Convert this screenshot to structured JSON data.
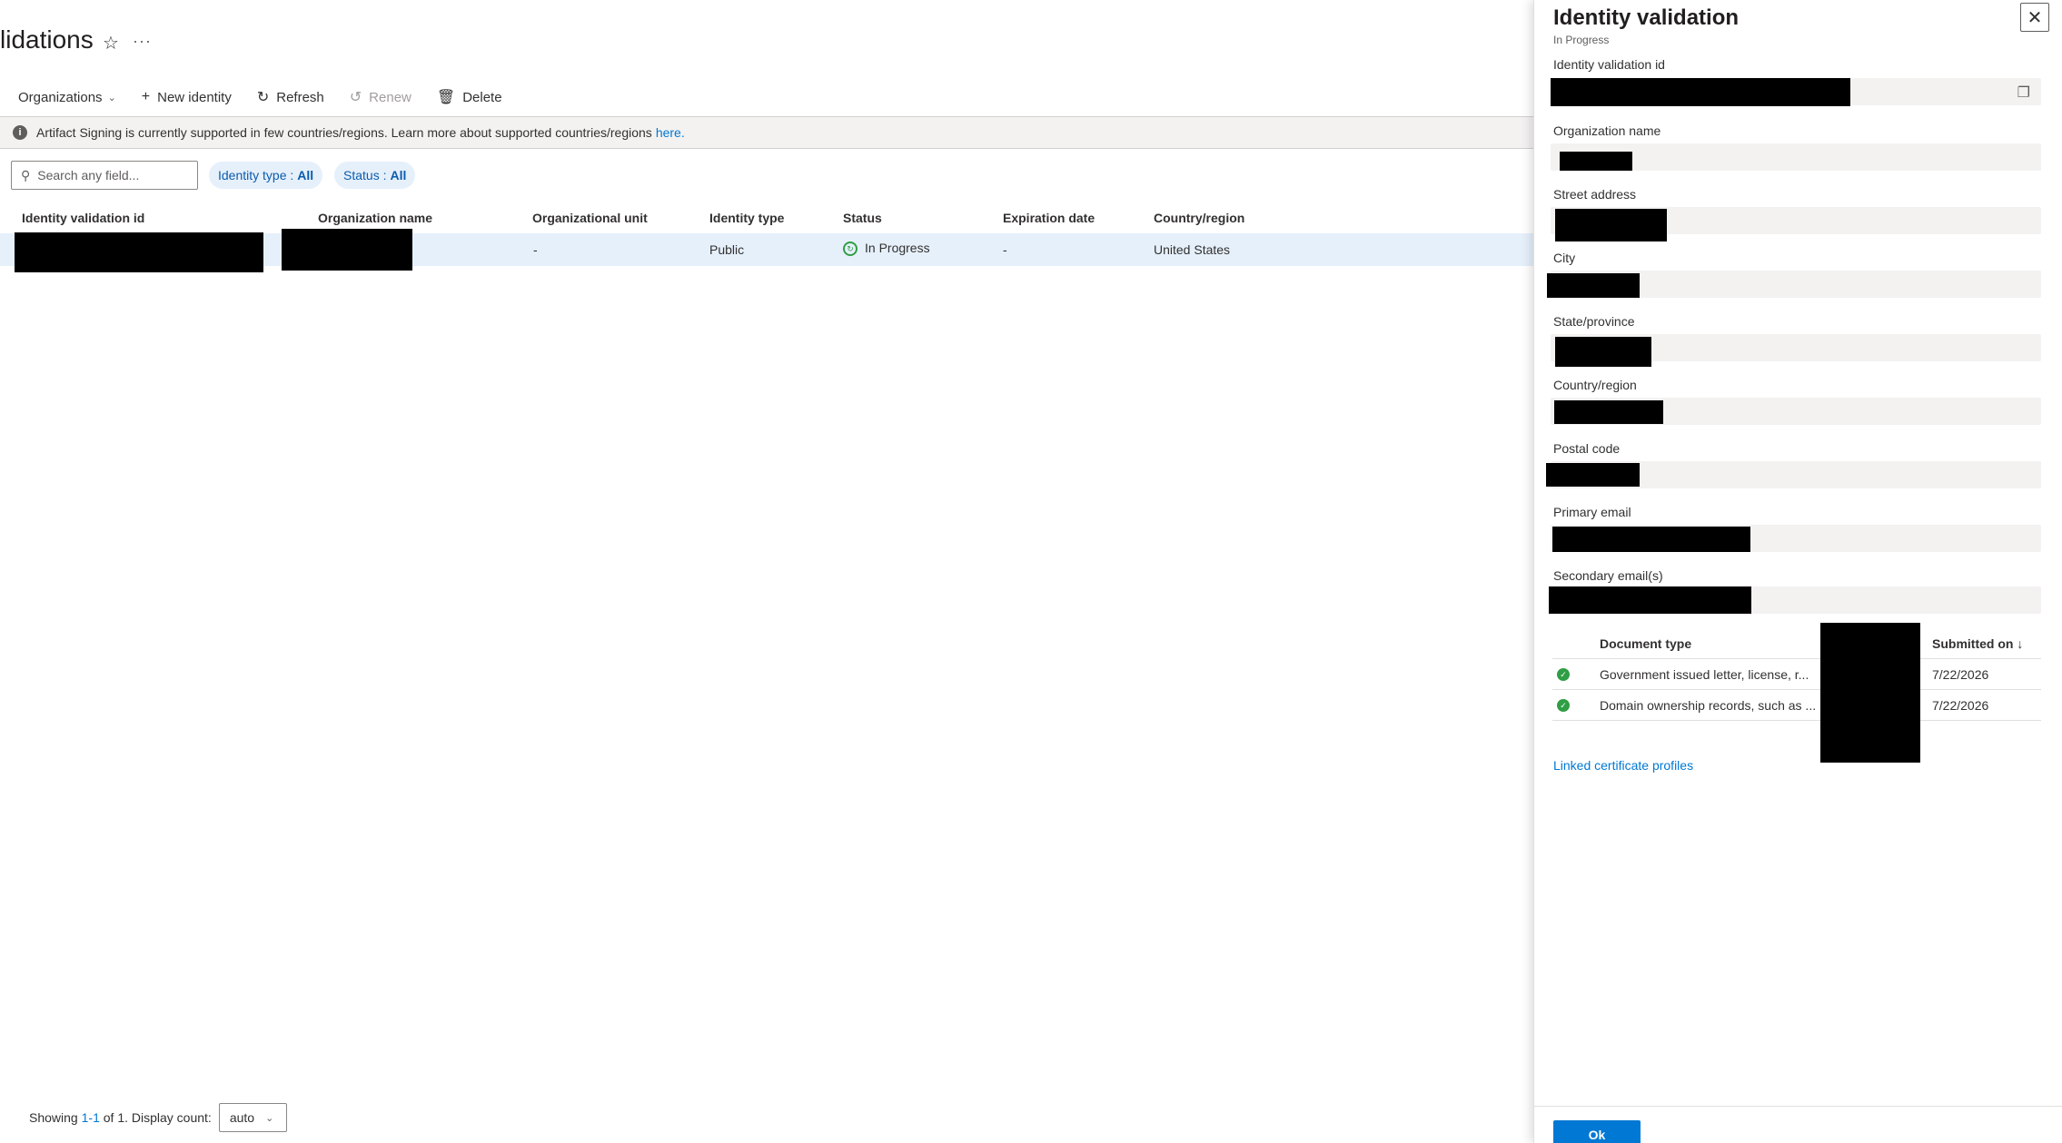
{
  "page": {
    "title": "lidations"
  },
  "toolbar": {
    "organizations": "Organizations",
    "new_identity": "New identity",
    "refresh": "Refresh",
    "renew": "Renew",
    "delete": "Delete"
  },
  "info": {
    "text": "Artifact Signing is currently supported in few countries/regions. Learn more about supported countries/regions",
    "link": "here."
  },
  "search": {
    "placeholder": "Search any field..."
  },
  "filters": {
    "identity_type": {
      "label": "Identity type :",
      "value": "All"
    },
    "status": {
      "label": "Status :",
      "value": "All"
    }
  },
  "grid": {
    "columns": [
      "Identity validation id",
      "Organization name",
      "Organizational unit",
      "Identity type",
      "Status",
      "Expiration date",
      "Country/region"
    ],
    "rows": [
      {
        "unit": "-",
        "type": "Public",
        "status": "In Progress",
        "expiration": "-",
        "country": "United States"
      }
    ]
  },
  "footer": {
    "showing": "Showing",
    "range_start": "1",
    "dash": " - ",
    "range_end": "1",
    "of": "of 1. Display count:",
    "display_value": "auto"
  },
  "panel": {
    "title": "Identity validation",
    "subtitle": "In Progress",
    "fields": {
      "id": "Identity validation id",
      "org": "Organization name",
      "street": "Street address",
      "city": "City",
      "state": "State/province",
      "country": "Country/region",
      "postal": "Postal code",
      "primary_email": "Primary email",
      "secondary_email": "Secondary email(s)"
    },
    "documents": {
      "col_type": "Document type",
      "col_submitted": "Submitted on ↓",
      "rows": [
        {
          "type": "Government issued letter, license, r...",
          "submitted": "7/22/2026"
        },
        {
          "type": "Domain ownership records, such as ...",
          "submitted": "7/22/2026"
        }
      ]
    },
    "linked": "Linked certificate profiles",
    "ok": "Ok"
  },
  "colors": {
    "accent": "#0078d4",
    "selected_row": "#e6f0fb",
    "success": "#2f9e44"
  }
}
